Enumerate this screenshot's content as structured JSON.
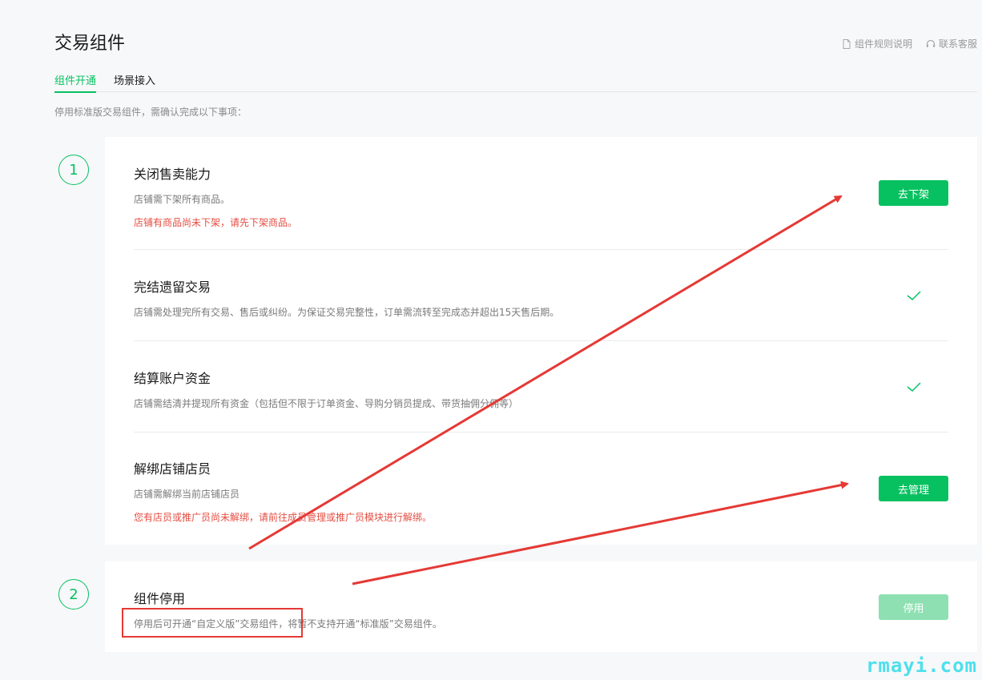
{
  "header": {
    "title": "交易组件",
    "links": [
      {
        "label": "组件规则说明",
        "icon": "document-icon"
      },
      {
        "label": "联系客服",
        "icon": "headset-icon"
      }
    ]
  },
  "tabs": [
    {
      "label": "组件开通",
      "active": true
    },
    {
      "label": "场景接入",
      "active": false
    }
  ],
  "intro": "停用标准版交易组件，需确认完成以下事项：",
  "steps": [
    {
      "number": "1",
      "items": [
        {
          "title": "关闭售卖能力",
          "desc": "店铺需下架所有商品。",
          "warning": "店铺有商品尚未下架，请先下架商品。",
          "action": "去下架",
          "done": false
        },
        {
          "title": "完结遗留交易",
          "desc": "店铺需处理完所有交易、售后或纠纷。为保证交易完整性，订单需流转至完成态并超出15天售后期。",
          "done": true
        },
        {
          "title": "结算账户资金",
          "desc": "店铺需结清并提现所有资金（包括但不限于订单资金、导购分销员提成、带货抽佣分佣等）",
          "done": true
        },
        {
          "title": "解绑店铺店员",
          "desc": "店铺需解绑当前店铺店员",
          "warning": "您有店员或推广员尚未解绑，请前往成员管理或推广员模块进行解绑。",
          "action": "去管理",
          "done": false
        }
      ]
    },
    {
      "number": "2",
      "items": [
        {
          "title": "组件停用",
          "desc": "停用后可开通“自定义版”交易组件，将暂不支持开通“标准版”交易组件。",
          "action": "停用",
          "disabled": true
        }
      ]
    }
  ],
  "colors": {
    "accent": "#07c160",
    "accent_disabled": "#8ee0b2",
    "warning": "#e54d42",
    "annotation": "#e53935"
  },
  "watermark": "rmayi.com"
}
